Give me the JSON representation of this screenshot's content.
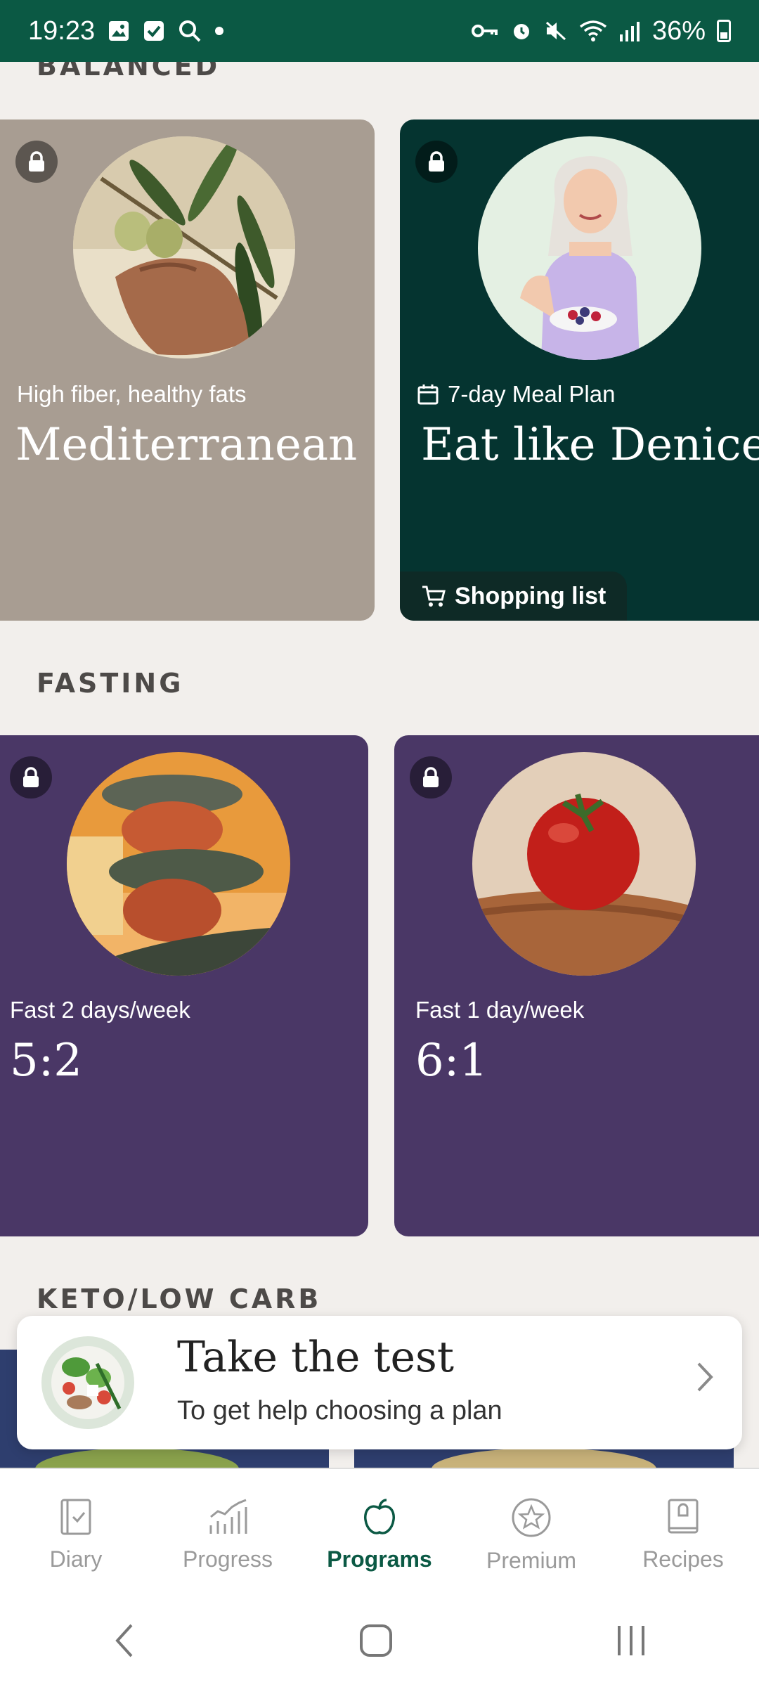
{
  "status": {
    "time": "19:23",
    "battery": "36%"
  },
  "sections": {
    "balanced": "BALANCED",
    "fasting": "FASTING",
    "keto": "KETO/LOW CARB"
  },
  "cards": {
    "mediterranean": {
      "subtitle": "High fiber, healthy fats",
      "title": "Mediterranean"
    },
    "denice": {
      "subtitle": "7-day Meal Plan",
      "title": "Eat like Denice",
      "shopping": "Shopping list"
    },
    "five_two": {
      "subtitle": "Fast 2 days/week",
      "title": "5:2"
    },
    "six_one": {
      "subtitle": "Fast 1 day/week",
      "title": "6:1"
    }
  },
  "banner": {
    "title": "Take the test",
    "subtitle": "To get help choosing a plan"
  },
  "nav": {
    "items": [
      {
        "label": "Diary",
        "icon": "diary-icon"
      },
      {
        "label": "Progress",
        "icon": "progress-icon"
      },
      {
        "label": "Programs",
        "icon": "apple-icon",
        "active": true
      },
      {
        "label": "Premium",
        "icon": "star-icon"
      },
      {
        "label": "Recipes",
        "icon": "recipes-icon"
      }
    ]
  },
  "colors": {
    "brand_green": "#0B5944",
    "card_balanced": "#A89D92",
    "card_denice": "#053430",
    "card_fasting": "#4A3766"
  }
}
